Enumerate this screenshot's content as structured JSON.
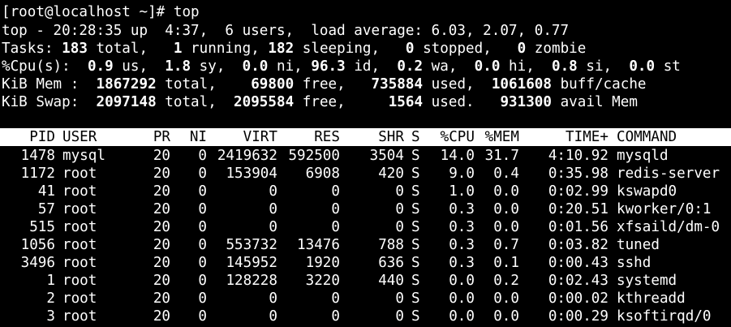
{
  "terminal": {
    "prompt": "[root@localhost ~]# top",
    "summary": {
      "uptime_line": "top - 20:28:35 up  4:37,  6 users,  load average: 6.03, 2.07, 0.77",
      "tasks": {
        "label": "Tasks:",
        "total": "183",
        "total_label": " total,",
        "running": "1",
        "running_label": " running,",
        "sleeping": "182",
        "sleeping_label": " sleeping,",
        "stopped": "0",
        "stopped_label": " stopped,",
        "zombie": "0",
        "zombie_label": " zombie"
      },
      "cpu": {
        "label": "%Cpu(s):",
        "us": "0.9",
        "us_label": " us,",
        "sy": "1.8",
        "sy_label": " sy,",
        "ni": "0.0",
        "ni_label": " ni,",
        "id": "96.3",
        "id_label": " id,",
        "wa": "0.2",
        "wa_label": " wa,",
        "hi": "0.0",
        "hi_label": " hi,",
        "si": "0.8",
        "si_label": " si,",
        "st": "0.0",
        "st_label": " st"
      },
      "mem": {
        "label": "KiB Mem :",
        "total": "1867292",
        "total_label": " total,",
        "free": "69800",
        "free_label": " free,",
        "used": "735884",
        "used_label": " used,",
        "buff": "1061608",
        "buff_label": " buff/cache"
      },
      "swap": {
        "label": "KiB Swap:",
        "total": "2097148",
        "total_label": " total,",
        "free": "2095584",
        "free_label": " free,",
        "used": "1564",
        "used_label": " used.",
        "avail": "931300",
        "avail_label": " avail Mem"
      }
    },
    "columns": [
      "PID",
      "USER",
      "PR",
      "NI",
      "VIRT",
      "RES",
      "SHR",
      "S",
      "%CPU",
      "%MEM",
      "TIME+",
      "COMMAND"
    ],
    "processes": [
      [
        "1478",
        "mysql",
        "20",
        "0",
        "2419632",
        "592500",
        "3504",
        "S",
        "14.0",
        "31.7",
        "4:10.92",
        "mysqld"
      ],
      [
        "1172",
        "root",
        "20",
        "0",
        "153904",
        "6908",
        "420",
        "S",
        "9.0",
        "0.4",
        "0:35.98",
        "redis-server"
      ],
      [
        "41",
        "root",
        "20",
        "0",
        "0",
        "0",
        "0",
        "S",
        "1.0",
        "0.0",
        "0:02.99",
        "kswapd0"
      ],
      [
        "57",
        "root",
        "20",
        "0",
        "0",
        "0",
        "0",
        "S",
        "0.3",
        "0.0",
        "0:20.51",
        "kworker/0:1"
      ],
      [
        "515",
        "root",
        "20",
        "0",
        "0",
        "0",
        "0",
        "S",
        "0.3",
        "0.0",
        "0:01.56",
        "xfsaild/dm-0"
      ],
      [
        "1056",
        "root",
        "20",
        "0",
        "553732",
        "13476",
        "788",
        "S",
        "0.3",
        "0.7",
        "0:03.82",
        "tuned"
      ],
      [
        "3496",
        "root",
        "20",
        "0",
        "145952",
        "1920",
        "636",
        "S",
        "0.3",
        "0.1",
        "0:00.43",
        "sshd"
      ],
      [
        "1",
        "root",
        "20",
        "0",
        "128228",
        "3220",
        "440",
        "S",
        "0.0",
        "0.2",
        "0:02.43",
        "systemd"
      ],
      [
        "2",
        "root",
        "20",
        "0",
        "0",
        "0",
        "0",
        "S",
        "0.0",
        "0.0",
        "0:00.02",
        "kthreadd"
      ],
      [
        "3",
        "root",
        "20",
        "0",
        "0",
        "0",
        "0",
        "S",
        "0.0",
        "0.0",
        "0:00.29",
        "ksoftirqd/0"
      ]
    ],
    "colors": {
      "background": "#000000",
      "foreground": "#ffffff",
      "header_bg": "#ffffff",
      "header_fg": "#000000"
    }
  }
}
